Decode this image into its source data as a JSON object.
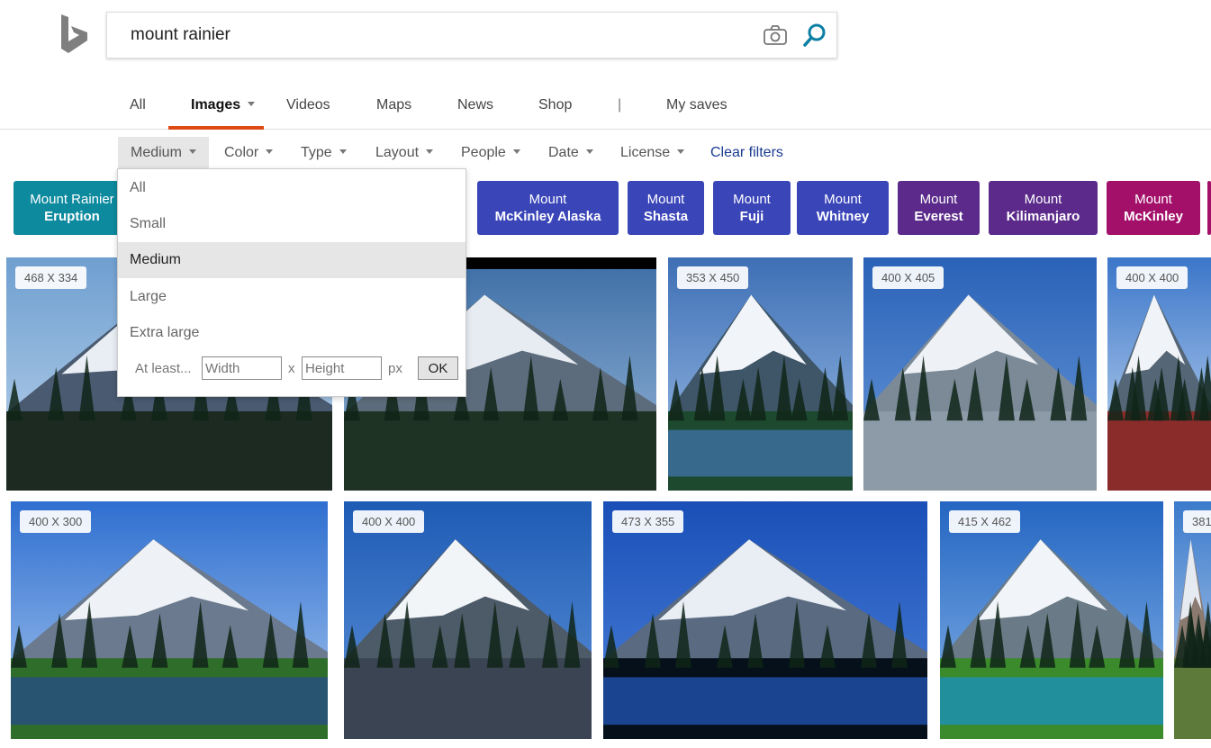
{
  "search": {
    "query": "mount rainier"
  },
  "nav": {
    "all": "All",
    "images": "Images",
    "videos": "Videos",
    "maps": "Maps",
    "news": "News",
    "shop": "Shop",
    "separator": "|",
    "my_saves": "My saves"
  },
  "filters": {
    "size": "Medium",
    "color": "Color",
    "type": "Type",
    "layout": "Layout",
    "people": "People",
    "date": "Date",
    "license": "License",
    "clear": "Clear filters"
  },
  "size_dropdown": {
    "options": [
      "All",
      "Small",
      "Medium",
      "Large",
      "Extra large"
    ],
    "selected": "Medium",
    "at_least_label": "At least...",
    "width_placeholder": "Width",
    "height_placeholder": "Height",
    "x_label": "x",
    "px_label": "px",
    "ok_label": "OK"
  },
  "related": [
    {
      "line1": "Mount Rainier",
      "line2": "Eruption",
      "color": "#0e8a9e"
    },
    {
      "line1": "Mount",
      "line2": "McKinley Alaska",
      "color": "#3a45b8"
    },
    {
      "line1": "Mount",
      "line2": "Shasta",
      "color": "#3a45b8"
    },
    {
      "line1": "Mount",
      "line2": "Fuji",
      "color": "#3a45b8"
    },
    {
      "line1": "Mount",
      "line2": "Whitney",
      "color": "#3a45b8"
    },
    {
      "line1": "Mount",
      "line2": "Everest",
      "color": "#5b2a8a"
    },
    {
      "line1": "Mount",
      "line2": "Kilimanjaro",
      "color": "#5b2a8a"
    },
    {
      "line1": "Mount",
      "line2": "McKinley",
      "color": "#a3106a"
    }
  ],
  "images": [
    {
      "dims": "468 X 334"
    },
    {
      "dims": ""
    },
    {
      "dims": "353 X 450"
    },
    {
      "dims": "400 X 405"
    },
    {
      "dims": "400 X 400"
    },
    {
      "dims": "400 X 300"
    },
    {
      "dims": "400 X 400"
    },
    {
      "dims": "473 X 355"
    },
    {
      "dims": "415 X 462"
    },
    {
      "dims": "381"
    }
  ],
  "colors": {
    "accent": "#de4a14",
    "link": "#1a3b8f",
    "search_icon": "#0c7fa4"
  }
}
